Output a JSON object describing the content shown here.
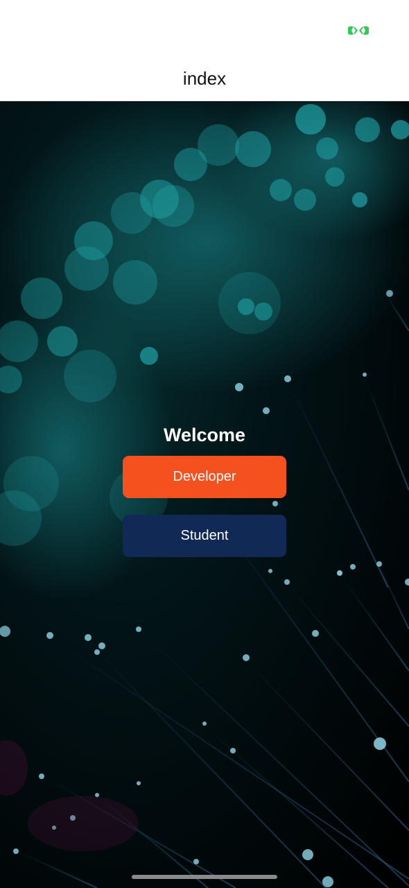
{
  "status_bar": {
    "indicator_icon": "camera-in-use-icon",
    "indicator_color": "#34c759"
  },
  "nav": {
    "title": "index"
  },
  "main": {
    "welcome": "Welcome",
    "developer_label": "Developer",
    "student_label": "Student"
  },
  "colors": {
    "developer_button": "#f4511e",
    "student_button": "#112a55",
    "background": "#01080a",
    "bokeh": "#1fa3a6"
  },
  "background": {
    "description_icon": "fiber-optic-background-image"
  }
}
